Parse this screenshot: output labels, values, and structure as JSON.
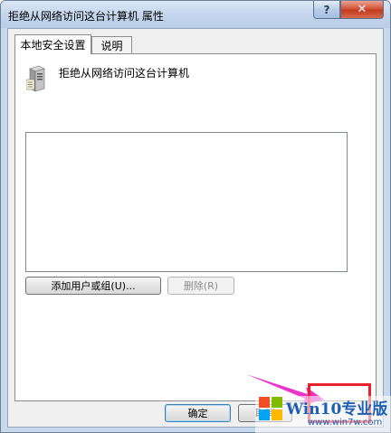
{
  "window": {
    "title": "拒绝从网络访问这台计算机 属性",
    "help_glyph": "?",
    "close_glyph": "✕"
  },
  "tabs": [
    {
      "label": "本地安全设置",
      "active": true
    },
    {
      "label": "说明",
      "active": false
    }
  ],
  "policy": {
    "name": "拒绝从网络访问这台计算机",
    "icon": "server-policy-icon",
    "users": []
  },
  "buttons": {
    "add": "添加用户或组(U)...",
    "remove": "删除(R)",
    "ok": "确定",
    "cancel": "取消"
  },
  "watermark": {
    "main": "Win10专业版",
    "url": "www.win7w.com"
  },
  "colors": {
    "annotation_arrow": "#ee33cc",
    "annotation_box": "#e8202a"
  }
}
